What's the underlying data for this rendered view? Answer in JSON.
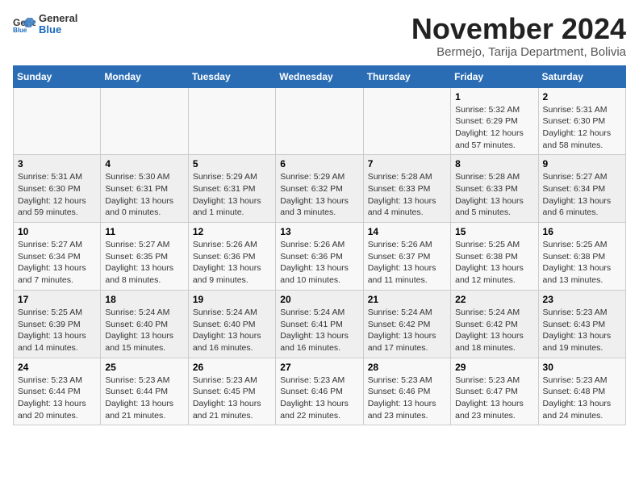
{
  "header": {
    "logo_general": "General",
    "logo_blue": "Blue",
    "month_year": "November 2024",
    "location": "Bermejo, Tarija Department, Bolivia"
  },
  "weekdays": [
    "Sunday",
    "Monday",
    "Tuesday",
    "Wednesday",
    "Thursday",
    "Friday",
    "Saturday"
  ],
  "weeks": [
    [
      {
        "day": "",
        "info": ""
      },
      {
        "day": "",
        "info": ""
      },
      {
        "day": "",
        "info": ""
      },
      {
        "day": "",
        "info": ""
      },
      {
        "day": "",
        "info": ""
      },
      {
        "day": "1",
        "info": "Sunrise: 5:32 AM\nSunset: 6:29 PM\nDaylight: 12 hours and 57 minutes."
      },
      {
        "day": "2",
        "info": "Sunrise: 5:31 AM\nSunset: 6:30 PM\nDaylight: 12 hours and 58 minutes."
      }
    ],
    [
      {
        "day": "3",
        "info": "Sunrise: 5:31 AM\nSunset: 6:30 PM\nDaylight: 12 hours and 59 minutes."
      },
      {
        "day": "4",
        "info": "Sunrise: 5:30 AM\nSunset: 6:31 PM\nDaylight: 13 hours and 0 minutes."
      },
      {
        "day": "5",
        "info": "Sunrise: 5:29 AM\nSunset: 6:31 PM\nDaylight: 13 hours and 1 minute."
      },
      {
        "day": "6",
        "info": "Sunrise: 5:29 AM\nSunset: 6:32 PM\nDaylight: 13 hours and 3 minutes."
      },
      {
        "day": "7",
        "info": "Sunrise: 5:28 AM\nSunset: 6:33 PM\nDaylight: 13 hours and 4 minutes."
      },
      {
        "day": "8",
        "info": "Sunrise: 5:28 AM\nSunset: 6:33 PM\nDaylight: 13 hours and 5 minutes."
      },
      {
        "day": "9",
        "info": "Sunrise: 5:27 AM\nSunset: 6:34 PM\nDaylight: 13 hours and 6 minutes."
      }
    ],
    [
      {
        "day": "10",
        "info": "Sunrise: 5:27 AM\nSunset: 6:34 PM\nDaylight: 13 hours and 7 minutes."
      },
      {
        "day": "11",
        "info": "Sunrise: 5:27 AM\nSunset: 6:35 PM\nDaylight: 13 hours and 8 minutes."
      },
      {
        "day": "12",
        "info": "Sunrise: 5:26 AM\nSunset: 6:36 PM\nDaylight: 13 hours and 9 minutes."
      },
      {
        "day": "13",
        "info": "Sunrise: 5:26 AM\nSunset: 6:36 PM\nDaylight: 13 hours and 10 minutes."
      },
      {
        "day": "14",
        "info": "Sunrise: 5:26 AM\nSunset: 6:37 PM\nDaylight: 13 hours and 11 minutes."
      },
      {
        "day": "15",
        "info": "Sunrise: 5:25 AM\nSunset: 6:38 PM\nDaylight: 13 hours and 12 minutes."
      },
      {
        "day": "16",
        "info": "Sunrise: 5:25 AM\nSunset: 6:38 PM\nDaylight: 13 hours and 13 minutes."
      }
    ],
    [
      {
        "day": "17",
        "info": "Sunrise: 5:25 AM\nSunset: 6:39 PM\nDaylight: 13 hours and 14 minutes."
      },
      {
        "day": "18",
        "info": "Sunrise: 5:24 AM\nSunset: 6:40 PM\nDaylight: 13 hours and 15 minutes."
      },
      {
        "day": "19",
        "info": "Sunrise: 5:24 AM\nSunset: 6:40 PM\nDaylight: 13 hours and 16 minutes."
      },
      {
        "day": "20",
        "info": "Sunrise: 5:24 AM\nSunset: 6:41 PM\nDaylight: 13 hours and 16 minutes."
      },
      {
        "day": "21",
        "info": "Sunrise: 5:24 AM\nSunset: 6:42 PM\nDaylight: 13 hours and 17 minutes."
      },
      {
        "day": "22",
        "info": "Sunrise: 5:24 AM\nSunset: 6:42 PM\nDaylight: 13 hours and 18 minutes."
      },
      {
        "day": "23",
        "info": "Sunrise: 5:23 AM\nSunset: 6:43 PM\nDaylight: 13 hours and 19 minutes."
      }
    ],
    [
      {
        "day": "24",
        "info": "Sunrise: 5:23 AM\nSunset: 6:44 PM\nDaylight: 13 hours and 20 minutes."
      },
      {
        "day": "25",
        "info": "Sunrise: 5:23 AM\nSunset: 6:44 PM\nDaylight: 13 hours and 21 minutes."
      },
      {
        "day": "26",
        "info": "Sunrise: 5:23 AM\nSunset: 6:45 PM\nDaylight: 13 hours and 21 minutes."
      },
      {
        "day": "27",
        "info": "Sunrise: 5:23 AM\nSunset: 6:46 PM\nDaylight: 13 hours and 22 minutes."
      },
      {
        "day": "28",
        "info": "Sunrise: 5:23 AM\nSunset: 6:46 PM\nDaylight: 13 hours and 23 minutes."
      },
      {
        "day": "29",
        "info": "Sunrise: 5:23 AM\nSunset: 6:47 PM\nDaylight: 13 hours and 23 minutes."
      },
      {
        "day": "30",
        "info": "Sunrise: 5:23 AM\nSunset: 6:48 PM\nDaylight: 13 hours and 24 minutes."
      }
    ]
  ]
}
